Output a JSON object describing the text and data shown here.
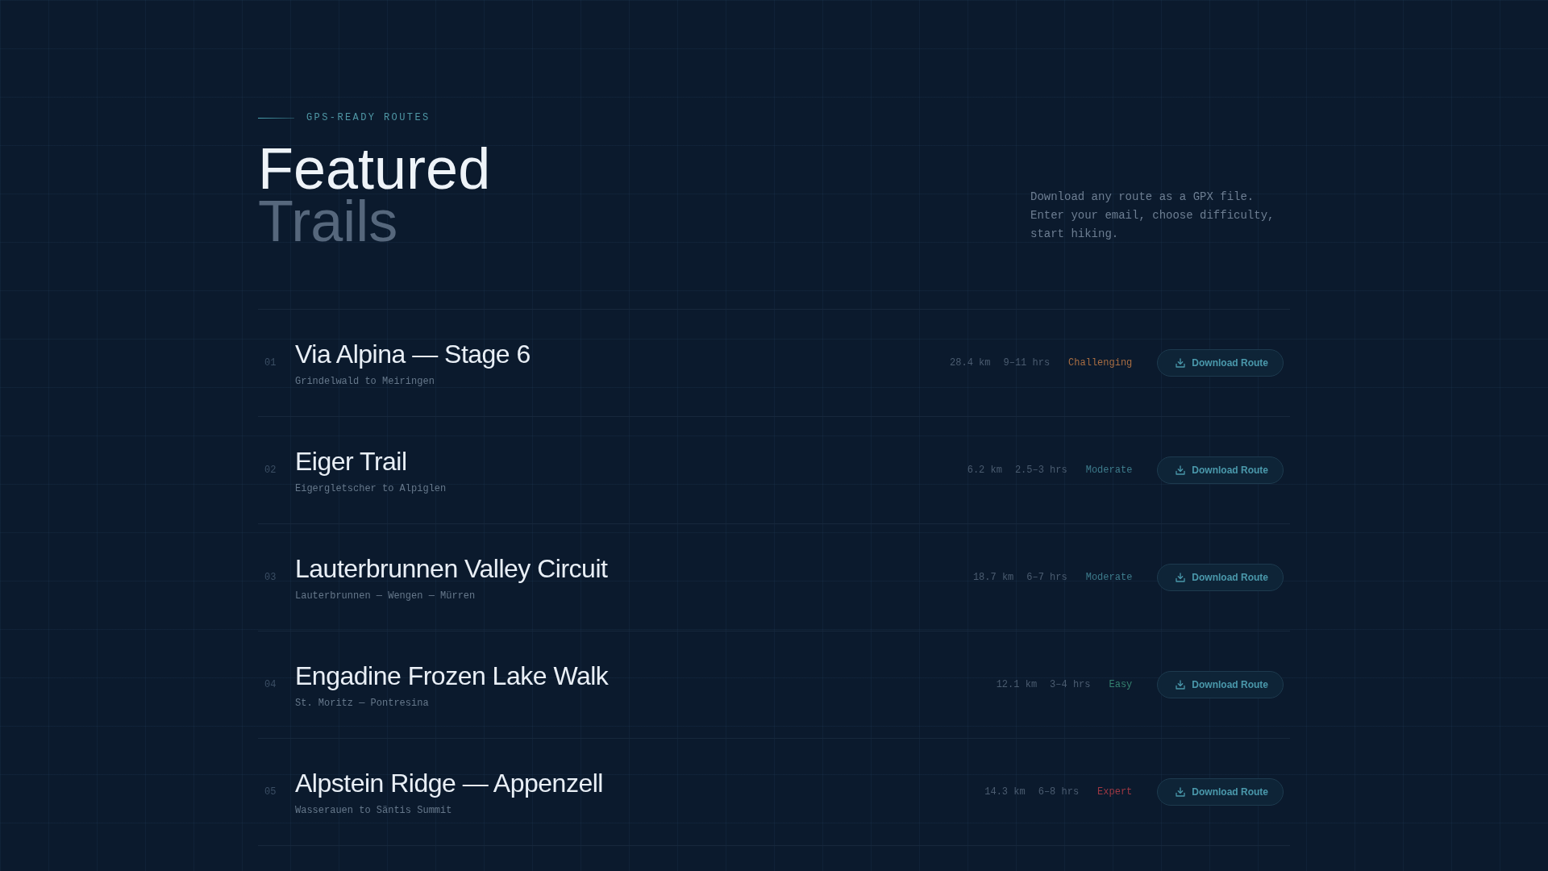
{
  "header": {
    "eyebrow": "GPS-READY ROUTES",
    "heading": [
      "Featured",
      "Trails"
    ],
    "description": "Download any route as a GPX file. Enter your email, choose difficulty, start hiking."
  },
  "routes": [
    {
      "number": "01",
      "name": "Via Alpina — Stage 6",
      "subtitle": "Grindelwald to Meiringen",
      "distance": "28.4 km",
      "duration": "9–11 hrs",
      "difficulty": {
        "label": "Challenging",
        "color": "#a86d42"
      },
      "action": "Download Route"
    },
    {
      "number": "02",
      "name": "Eiger Trail",
      "subtitle": "Eigergletscher to Alpiglen",
      "distance": "6.2 km",
      "duration": "2.5–3 hrs",
      "difficulty": {
        "label": "Moderate",
        "color": "#3d7b8b"
      },
      "action": "Download Route"
    },
    {
      "number": "03",
      "name": "Lauterbrunnen Valley Circuit",
      "subtitle": "Lauterbrunnen — Wengen — Mürren",
      "distance": "18.7 km",
      "duration": "6–7 hrs",
      "difficulty": {
        "label": "Moderate",
        "color": "#3d7b8b"
      },
      "action": "Download Route"
    },
    {
      "number": "04",
      "name": "Engadine Frozen Lake Walk",
      "subtitle": "St. Moritz — Pontresina",
      "distance": "12.1 km",
      "duration": "3–4 hrs",
      "difficulty": {
        "label": "Easy",
        "color": "#34806f"
      },
      "action": "Download Route"
    },
    {
      "number": "05",
      "name": "Alpstein Ridge — Appenzell",
      "subtitle": "Wasserauen to Säntis Summit",
      "distance": "14.3 km",
      "duration": "6–8 hrs",
      "difficulty": {
        "label": "Expert",
        "color": "#9e3843"
      },
      "action": "Download Route"
    }
  ]
}
